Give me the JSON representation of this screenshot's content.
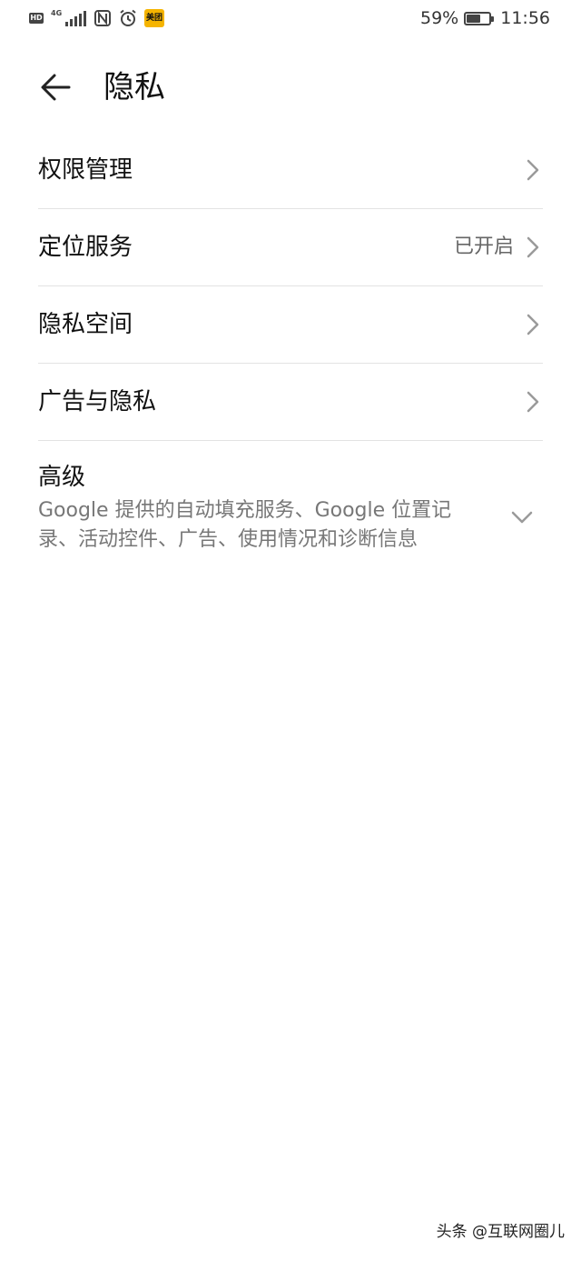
{
  "status_bar": {
    "hd": "HD",
    "network": "4G",
    "app_badge": "美团",
    "battery": "59%",
    "time": "11:56"
  },
  "header": {
    "title": "隐私"
  },
  "items": [
    {
      "label": "权限管理",
      "value": ""
    },
    {
      "label": "定位服务",
      "value": "已开启"
    },
    {
      "label": "隐私空间",
      "value": ""
    },
    {
      "label": "广告与隐私",
      "value": ""
    }
  ],
  "advanced": {
    "title": "高级",
    "description": "Google 提供的自动填充服务、Google 位置记录、活动控件、广告、使用情况和诊断信息"
  },
  "watermark": "头条 @互联网圈儿",
  "colors": {
    "background": "#ffffff",
    "text_primary": "#111111",
    "text_secondary": "#777777",
    "divider": "#e3e3e3"
  }
}
